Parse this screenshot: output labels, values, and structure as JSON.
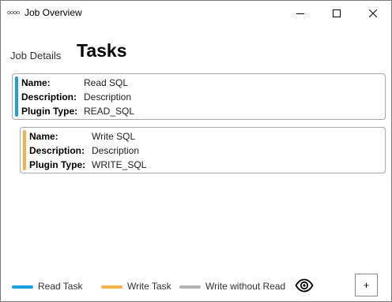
{
  "window": {
    "title": "Job Overview",
    "icon": "app-logo-icon",
    "controls": [
      "minimize-icon",
      "maximize-icon",
      "close-icon"
    ]
  },
  "header": {
    "tab_label": "Job Details",
    "title": "Tasks"
  },
  "tasks": [
    {
      "type": "read",
      "color": "#1ba1e2",
      "name_label": "Name:",
      "name": "Read SQL",
      "description_label": "Description:",
      "description": "Description",
      "plugin_label": "Plugin Type:",
      "plugin_type": "READ_SQL"
    },
    {
      "type": "write",
      "color": "#f0b448",
      "name_label": "Name:",
      "name": "Write SQL",
      "description_label": "Description:",
      "description": "Description",
      "plugin_label": "Plugin Type:",
      "plugin_type": "WRITE_SQL"
    }
  ],
  "legend": [
    {
      "label": "Read Task",
      "color": "#1ba1e2"
    },
    {
      "label": "Write Task",
      "color": "#f0b448"
    },
    {
      "label": "Write without Read",
      "color": "#b3b3b3"
    }
  ],
  "footer": {
    "visibility_icon": "eye-icon",
    "add_label": "+"
  }
}
